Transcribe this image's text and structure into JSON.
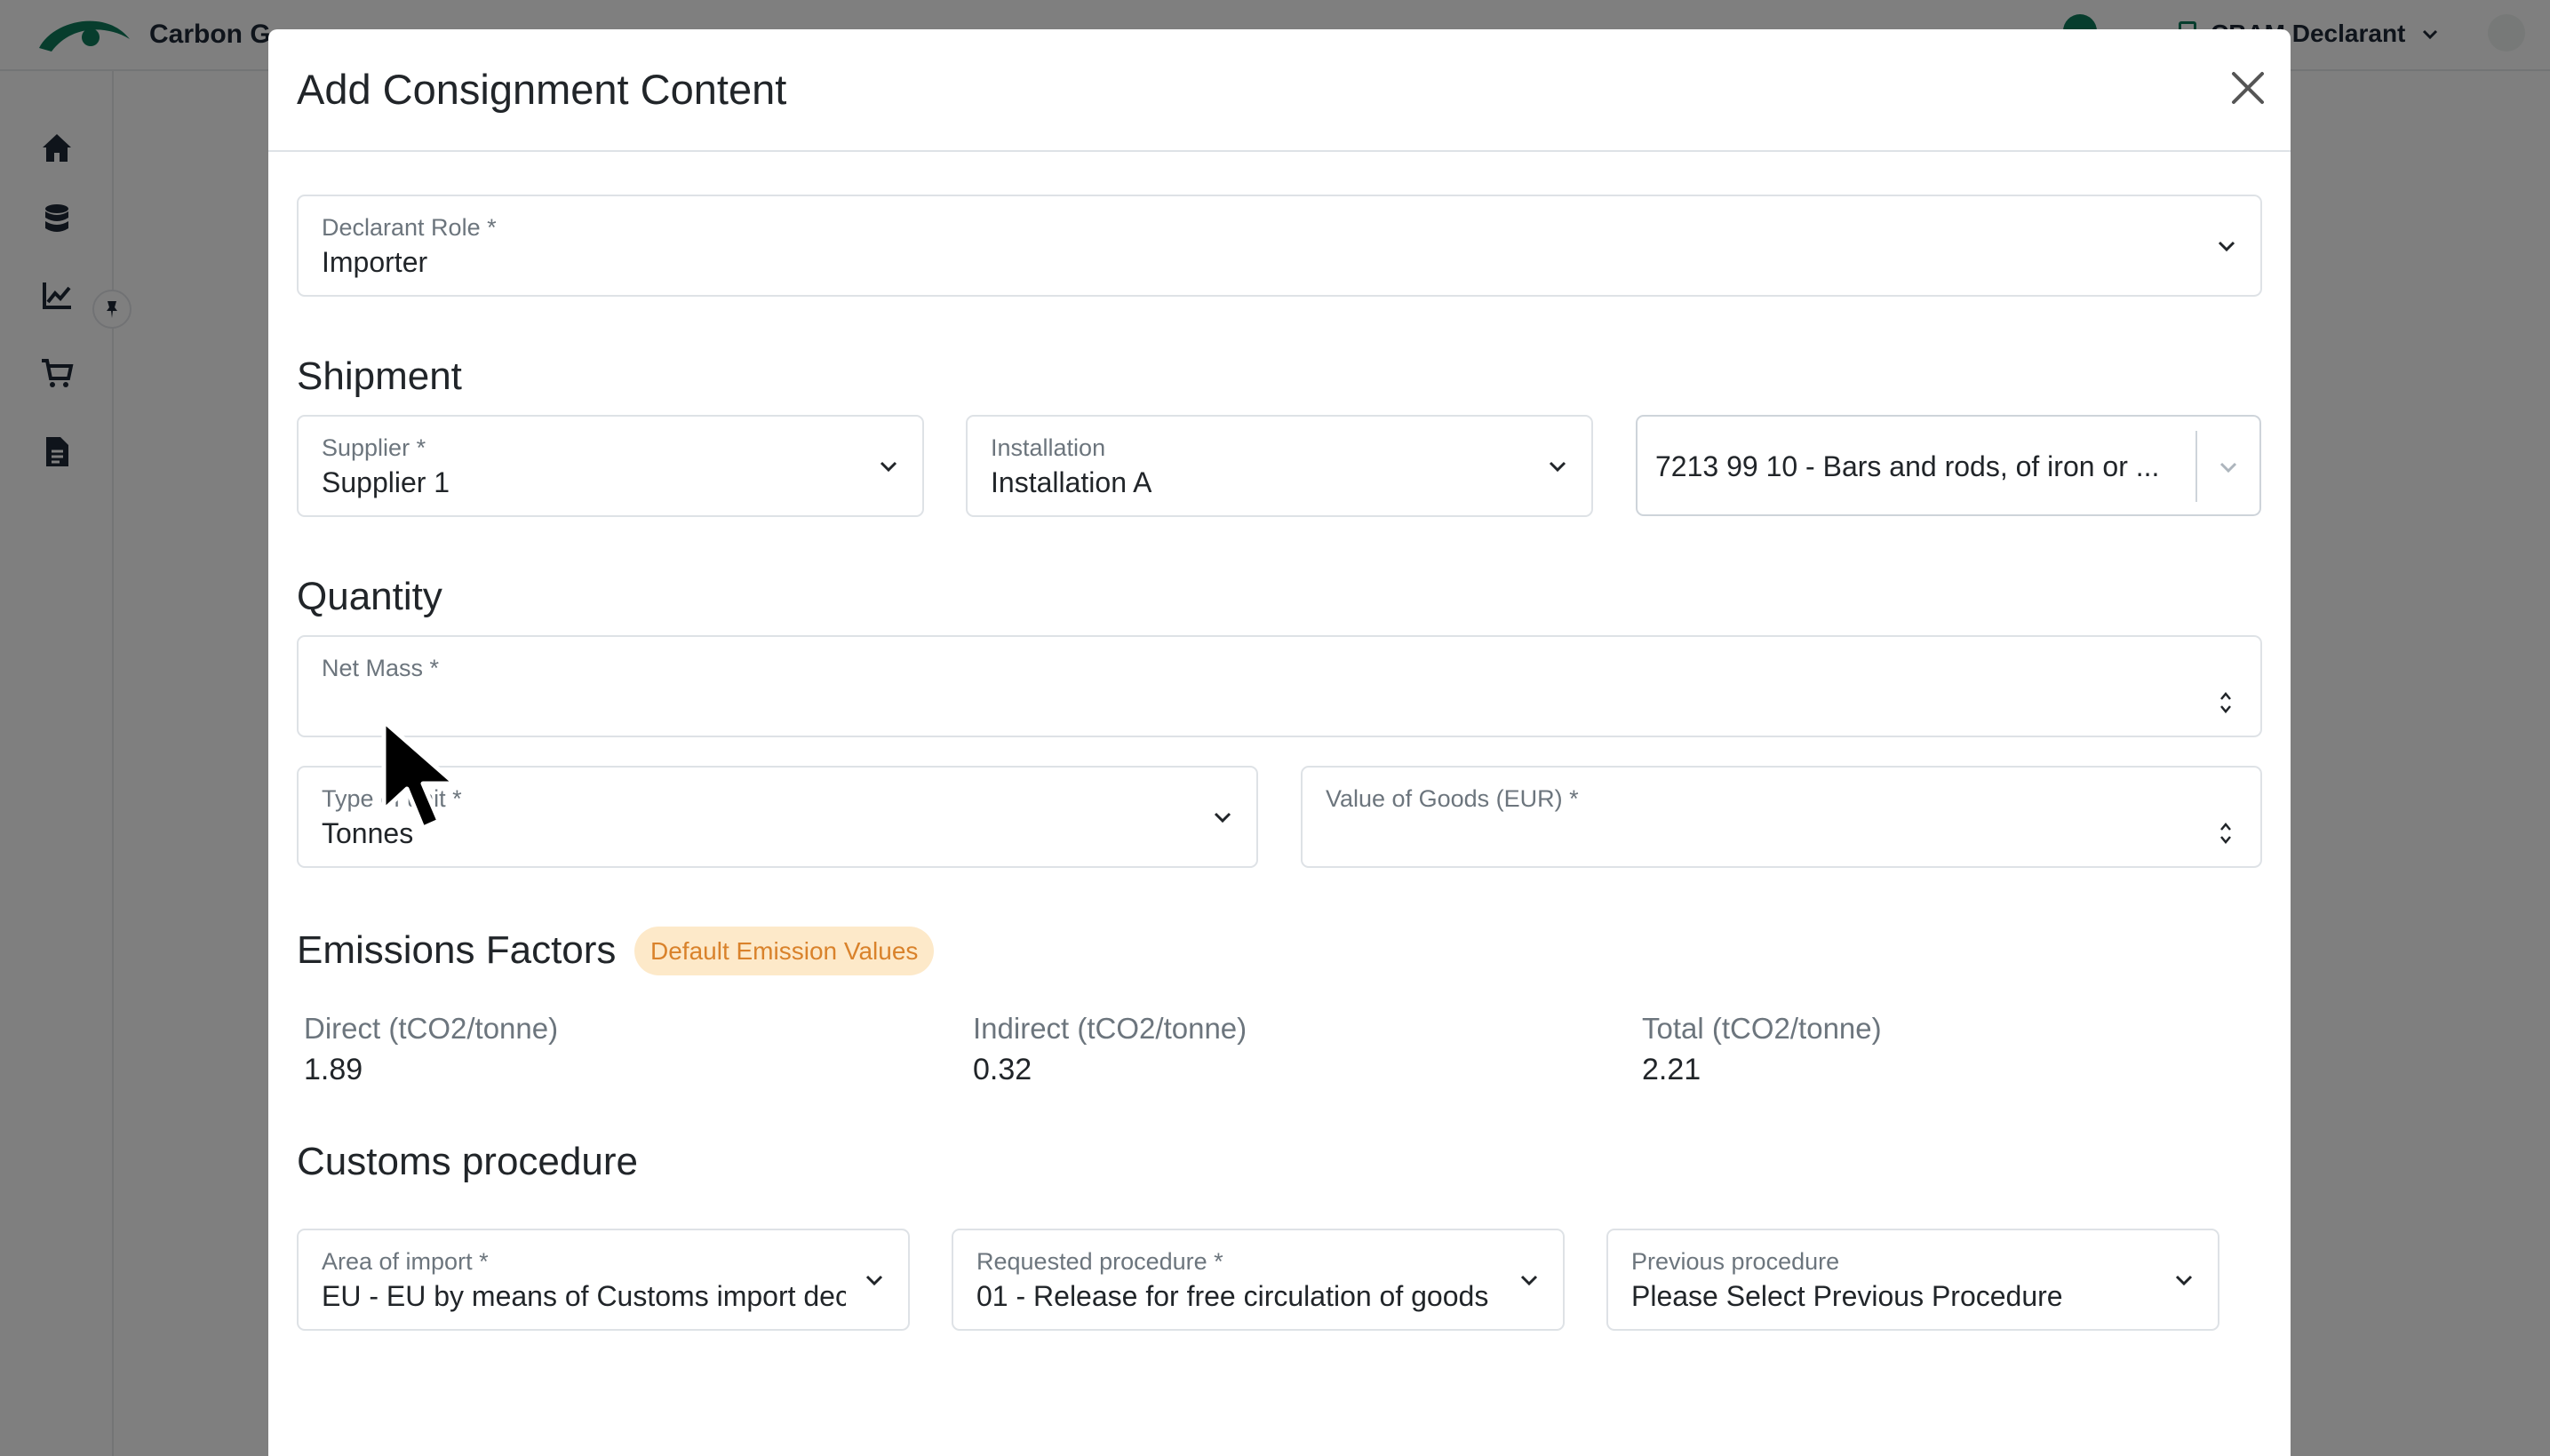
{
  "app": {
    "brand": "Carbon G",
    "user_name": "CBAM Declarant"
  },
  "modal": {
    "title": "Add Consignment Content",
    "declarant_role": {
      "label": "Declarant Role *",
      "value": "Importer"
    },
    "shipment": {
      "heading": "Shipment",
      "supplier": {
        "label": "Supplier *",
        "value": "Supplier 1"
      },
      "installation": {
        "label": "Installation",
        "value": "Installation A"
      },
      "cn_code": {
        "value": "7213 99 10 - Bars and rods, of iron or ..."
      }
    },
    "quantity": {
      "heading": "Quantity",
      "net_mass": {
        "label": "Net Mass *",
        "value": ""
      },
      "type_of_unit": {
        "label": "Type of unit *",
        "value": "Tonnes"
      },
      "value_of_goods": {
        "label": "Value of Goods (EUR) *",
        "value": ""
      }
    },
    "emissions": {
      "heading": "Emissions Factors",
      "badge": "Default Emission Values",
      "direct": {
        "label": "Direct (tCO2/tonne)",
        "value": "1.89"
      },
      "indirect": {
        "label": "Indirect (tCO2/tonne)",
        "value": "0.32"
      },
      "total": {
        "label": "Total (tCO2/tonne)",
        "value": "2.21"
      }
    },
    "customs": {
      "heading": "Customs procedure",
      "area_of_import": {
        "label": "Area of import *",
        "value": "EU - EU by means of Customs import declaration"
      },
      "requested_procedure": {
        "label": "Requested procedure *",
        "value": "01 - Release for free circulation of goods"
      },
      "previous_procedure": {
        "label": "Previous procedure",
        "value": "Please Select Previous Procedure"
      }
    }
  },
  "colors": {
    "brand_green": "#0e7a5a",
    "badge_bg": "#fde9c9",
    "badge_text": "#d9822b",
    "overlay": "rgba(0,0,0,0.5)"
  },
  "icons": {
    "sidebar": [
      "home-icon",
      "database-icon",
      "chart-line-icon",
      "cart-icon",
      "document-icon"
    ],
    "pin": "pin-icon",
    "close": "close-icon"
  }
}
